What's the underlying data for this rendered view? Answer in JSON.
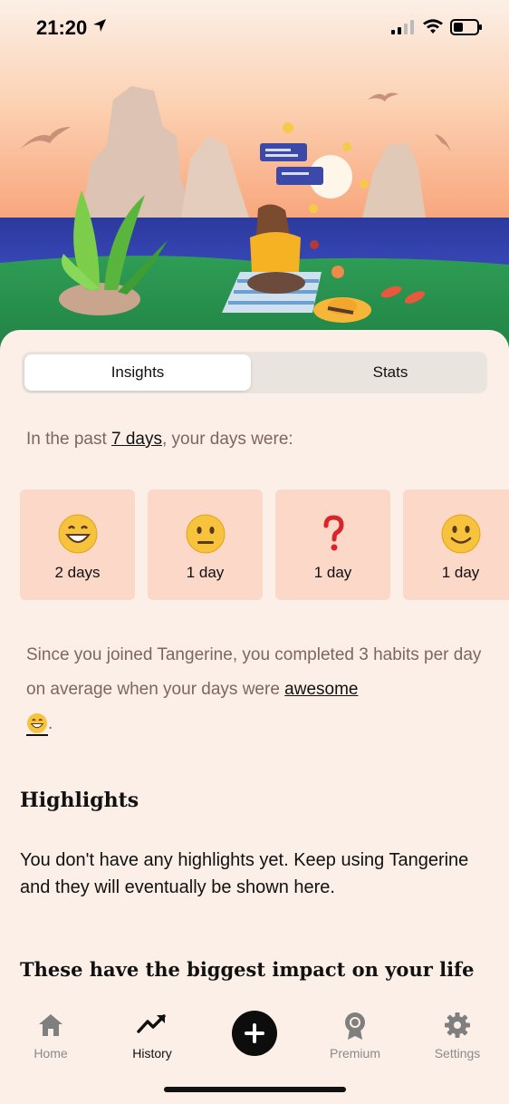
{
  "status_bar": {
    "time": "21:20"
  },
  "tabs": {
    "insights": "Insights",
    "stats": "Stats"
  },
  "summary": {
    "prefix": "In the past ",
    "period": "7 days",
    "suffix": ", your days were:"
  },
  "moods": [
    {
      "icon": "grinning-face-icon",
      "label": "2 days"
    },
    {
      "icon": "neutral-face-icon",
      "label": "1 day"
    },
    {
      "icon": "question-mark-icon",
      "label": "1 day"
    },
    {
      "icon": "slightly-smiling-face-icon",
      "label": "1 day"
    }
  ],
  "joined": {
    "text": "Since you joined Tangerine, you completed 3 habits per day on average when your days were ",
    "mood_word": "awesome",
    "end": "."
  },
  "highlights": {
    "title": "Highlights",
    "body": "You don't have any highlights yet. Keep using Tangerine and they will eventually be shown here."
  },
  "impact": {
    "title": "These have the biggest impact on your life"
  },
  "tab_bar": [
    {
      "label": "Home",
      "icon": "home-icon"
    },
    {
      "label": "History",
      "icon": "trending-up-icon"
    },
    {
      "label": "",
      "icon": "plus-icon"
    },
    {
      "label": "Premium",
      "icon": "award-icon"
    },
    {
      "label": "Settings",
      "icon": "gear-icon"
    }
  ],
  "colors": {
    "accent_card": "#fbd8c8",
    "background": "#fcefe7",
    "muted_text": "#7d6660"
  }
}
